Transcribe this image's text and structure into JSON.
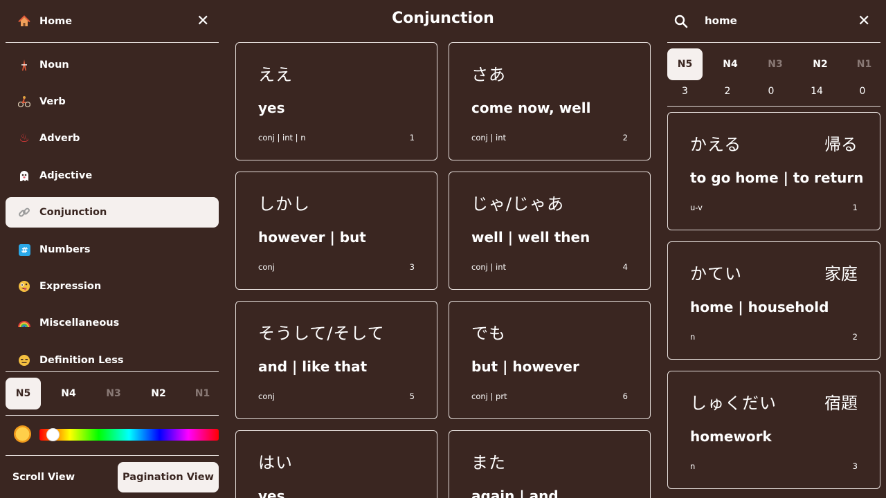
{
  "sidebar": {
    "home_label": "Home",
    "close": "✕",
    "items": [
      {
        "label": "Noun",
        "icon": "tower-icon",
        "glyph": "🗼",
        "color": "#e05a3a"
      },
      {
        "label": "Verb",
        "icon": "cyclist-icon",
        "glyph": "🚴",
        "color": "#e0a040"
      },
      {
        "label": "Adverb",
        "icon": "hot-springs-icon",
        "glyph": "♨",
        "color": "#e03a3a"
      },
      {
        "label": "Adjective",
        "icon": "ghost-icon",
        "glyph": "👻",
        "color": "#ffffff"
      },
      {
        "label": "Conjunction",
        "icon": "link-icon",
        "glyph": "🔗",
        "color": "#8a8a8a",
        "active": true
      },
      {
        "label": "Numbers",
        "icon": "hash-icon",
        "glyph": "#",
        "color": "#2aa8e8"
      },
      {
        "label": "Expression",
        "icon": "crazy-face-icon",
        "glyph": "🤪",
        "color": "#f5c040"
      },
      {
        "label": "Miscellaneous",
        "icon": "rainbow-icon",
        "glyph": "🌈",
        "color": "#e05a3a"
      },
      {
        "label": "Definition Less",
        "icon": "expressionless-face-icon",
        "glyph": "😑",
        "color": "#f5c040"
      }
    ],
    "levels": [
      "N5",
      "N4",
      "N3",
      "N2",
      "N1"
    ],
    "hue_level": 0.04,
    "scroll_view": "Scroll View",
    "pagination_view": "Pagination View"
  },
  "main": {
    "title": "Conjunction",
    "cards": [
      {
        "kana": "ええ",
        "meaning": "yes",
        "pos": "conj | int | n",
        "num": "1"
      },
      {
        "kana": "さあ",
        "meaning": "come now, well",
        "pos": "conj | int",
        "num": "2"
      },
      {
        "kana": "しかし",
        "meaning": "however | but",
        "pos": "conj",
        "num": "3"
      },
      {
        "kana": "じゃ/じゃあ",
        "meaning": "well | well then",
        "pos": "conj | int",
        "num": "4"
      },
      {
        "kana": "そうして/そして",
        "meaning": "and | like that",
        "pos": "conj",
        "num": "5"
      },
      {
        "kana": "でも",
        "meaning": "but | however",
        "pos": "conj | prt",
        "num": "6"
      },
      {
        "kana": "はい",
        "meaning": "yes",
        "pos": "",
        "num": ""
      },
      {
        "kana": "また",
        "meaning": "again | and",
        "pos": "",
        "num": ""
      }
    ]
  },
  "search": {
    "query": "home",
    "close": "✕",
    "levels": [
      "N5",
      "N4",
      "N3",
      "N2",
      "N1"
    ],
    "counts": [
      "3",
      "2",
      "0",
      "14",
      "0"
    ],
    "results": [
      {
        "kana": "かえる",
        "kanji": "帰る",
        "meaning": "to go home | to return",
        "pos": "u-v",
        "num": "1"
      },
      {
        "kana": "かてい",
        "kanji": "家庭",
        "meaning": "home | household",
        "pos": "n",
        "num": "2"
      },
      {
        "kana": "しゅくだい",
        "kanji": "宿題",
        "meaning": "homework",
        "pos": "n",
        "num": "3"
      }
    ]
  },
  "colors": {
    "background": "#3a2621",
    "active_bg": "#f5f0ee",
    "border": "#e8e1de",
    "dim_level": "#8a7a76"
  }
}
